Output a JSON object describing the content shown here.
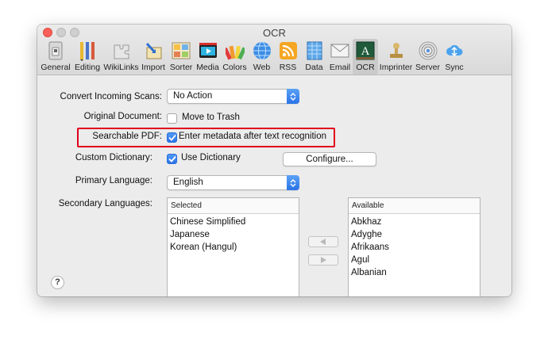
{
  "window": {
    "title": "OCR"
  },
  "toolbar": {
    "items": [
      {
        "label": "General",
        "icon": "general-icon"
      },
      {
        "label": "Editing",
        "icon": "editing-icon"
      },
      {
        "label": "WikiLinks",
        "icon": "wikilinks-icon"
      },
      {
        "label": "Import",
        "icon": "import-icon"
      },
      {
        "label": "Sorter",
        "icon": "sorter-icon"
      },
      {
        "label": "Media",
        "icon": "media-icon"
      },
      {
        "label": "Colors",
        "icon": "colors-icon"
      },
      {
        "label": "Web",
        "icon": "web-icon"
      },
      {
        "label": "RSS",
        "icon": "rss-icon"
      },
      {
        "label": "Data",
        "icon": "data-icon"
      },
      {
        "label": "Email",
        "icon": "email-icon"
      },
      {
        "label": "OCR",
        "icon": "ocr-icon",
        "active": true
      },
      {
        "label": "Imprinter",
        "icon": "imprinter-icon"
      },
      {
        "label": "Server",
        "icon": "server-icon"
      },
      {
        "label": "Sync",
        "icon": "sync-icon"
      }
    ]
  },
  "form": {
    "convert_incoming_scans": {
      "label": "Convert Incoming Scans:",
      "value": "No Action"
    },
    "original_document": {
      "label": "Original Document:",
      "checkbox_label": "Move to Trash",
      "checked": false
    },
    "searchable_pdf": {
      "label": "Searchable PDF:",
      "checkbox_label": "Enter metadata after text recognition",
      "checked": true
    },
    "custom_dictionary": {
      "label": "Custom Dictionary:",
      "checkbox_label": "Use Dictionary",
      "checked": true,
      "button_label": "Configure..."
    },
    "primary_language": {
      "label": "Primary Language:",
      "value": "English"
    },
    "secondary_languages": {
      "label": "Secondary Languages:",
      "selected_header": "Selected",
      "selected": [
        "Chinese Simplified",
        "Japanese",
        "Korean (Hangul)"
      ],
      "available_header": "Available",
      "available": [
        "Abkhaz",
        "Adyghe",
        "Afrikaans",
        "Agul",
        "Albanian"
      ]
    }
  },
  "help": {
    "label": "?"
  },
  "colors": {
    "accent": "#2a73e8",
    "highlight": "#e0001a"
  }
}
